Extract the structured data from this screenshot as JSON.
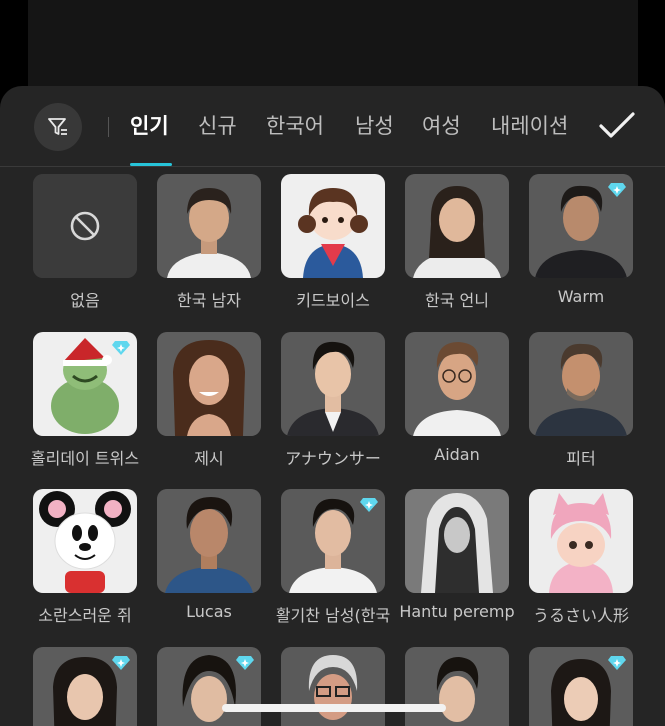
{
  "tabs": [
    {
      "label": "인기"
    },
    {
      "label": "신규"
    },
    {
      "label": "한국어"
    },
    {
      "label": "남성"
    },
    {
      "label": "여성"
    },
    {
      "label": "내레이션"
    }
  ],
  "active_tab": "인기",
  "accent_color": "#27c4d9",
  "premium_badge_color": "#5fd7ee",
  "voices": {
    "row1": [
      "없음",
      "한국 남자",
      "키드보이스",
      "한국 언니",
      "Warm"
    ],
    "row2": [
      "홀리데이 트위스",
      "제시",
      "アナウンサー",
      "Aidan",
      "피터"
    ],
    "row3": [
      "소란스러운 쥐",
      "Lucas",
      "활기찬 남성(한국",
      "Hantu peremp",
      "うるさい人形"
    ]
  },
  "icons": {
    "filter": "filter-icon",
    "confirm": "checkmark-icon",
    "none": "prohibited-icon",
    "premium": "diamond-icon"
  }
}
